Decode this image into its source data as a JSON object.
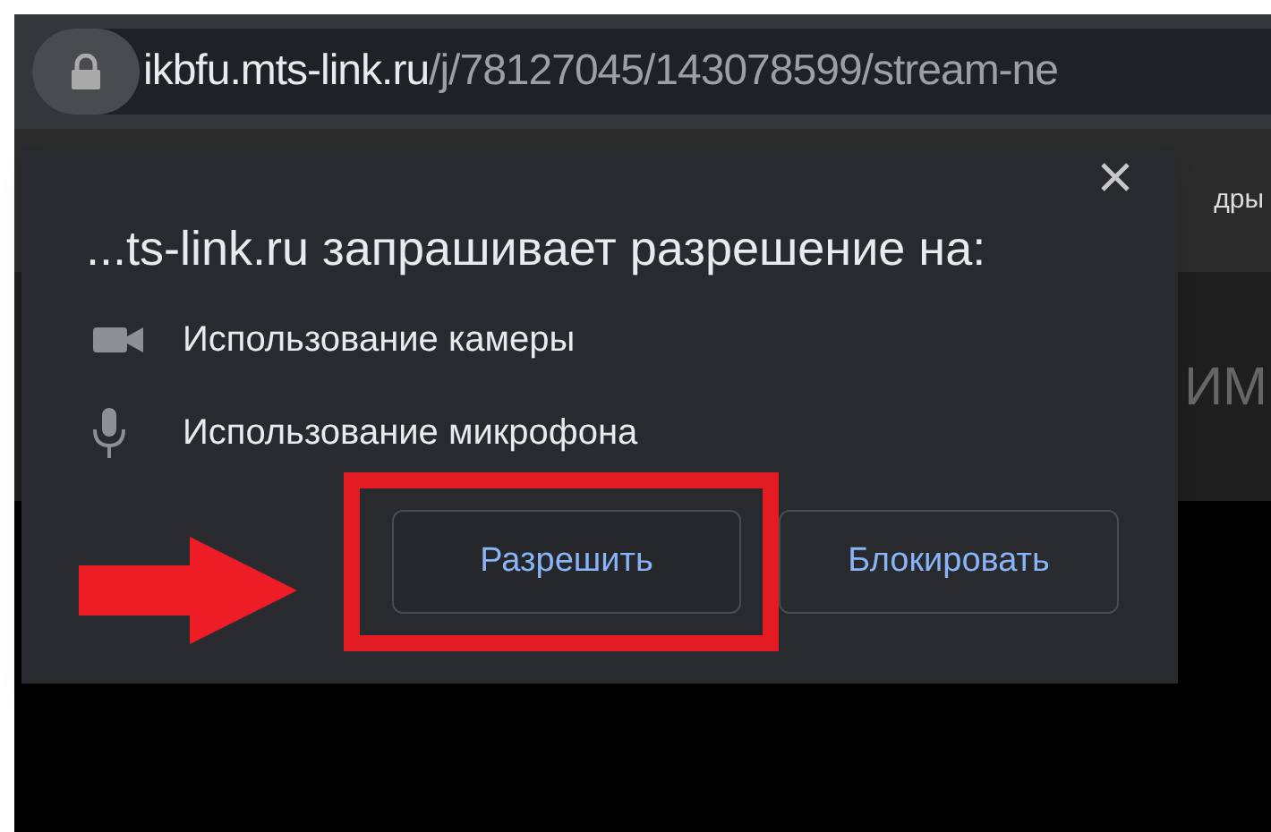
{
  "address_bar": {
    "domain": "ikbfu.mts-link.ru",
    "path": "/j/78127045/143078599/stream-ne"
  },
  "background": {
    "tab_strip_text": "дры",
    "page_text": "ИМ"
  },
  "permission_prompt": {
    "title": "...ts-link.ru запрашивает разрешение на:",
    "permissions": [
      {
        "kind": "camera",
        "label": "Использование камеры"
      },
      {
        "kind": "microphone",
        "label": "Использование микрофона"
      }
    ],
    "buttons": [
      {
        "label": "Разрешить"
      },
      {
        "label": "Блокировать"
      }
    ]
  }
}
